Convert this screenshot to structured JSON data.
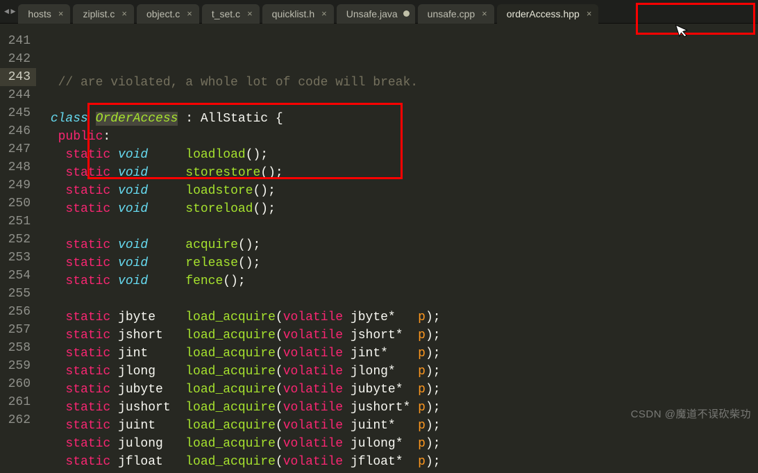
{
  "tabs": [
    {
      "label": "hosts",
      "dirty": false
    },
    {
      "label": "ziplist.c",
      "dirty": false
    },
    {
      "label": "object.c",
      "dirty": false
    },
    {
      "label": "t_set.c",
      "dirty": false
    },
    {
      "label": "quicklist.h",
      "dirty": false
    },
    {
      "label": "Unsafe.java",
      "dirty": true
    },
    {
      "label": "unsafe.cpp",
      "dirty": false
    },
    {
      "label": "orderAccess.hpp",
      "dirty": false,
      "active": true
    }
  ],
  "line_start": 241,
  "active_line": 243,
  "code_lines": [
    {
      "n": 241,
      "tokens": [
        {
          "t": "  // are violated, a whole lot of code will break.",
          "c": "c-comment"
        }
      ]
    },
    {
      "n": 242,
      "tokens": [
        {
          "t": " ",
          "c": "c-plain"
        }
      ]
    },
    {
      "n": 243,
      "tokens": [
        {
          "t": " ",
          "c": "c-plain"
        },
        {
          "t": "class",
          "c": "c-type"
        },
        {
          "t": " ",
          "c": "c-plain"
        },
        {
          "t": "OrderAccess",
          "c": "c-classname"
        },
        {
          "t": " : ",
          "c": "c-plain"
        },
        {
          "t": "AllStatic",
          "c": "c-plain"
        },
        {
          "t": " {",
          "c": "c-plain"
        }
      ]
    },
    {
      "n": 244,
      "tokens": [
        {
          "t": "  ",
          "c": "c-plain"
        },
        {
          "t": "public",
          "c": "c-keyword"
        },
        {
          "t": ":",
          "c": "c-plain"
        }
      ]
    },
    {
      "n": 245,
      "tokens": [
        {
          "t": "   ",
          "c": "c-plain"
        },
        {
          "t": "static",
          "c": "c-keyword"
        },
        {
          "t": " ",
          "c": "c-plain"
        },
        {
          "t": "void",
          "c": "c-type"
        },
        {
          "t": "     ",
          "c": "c-plain"
        },
        {
          "t": "loadload",
          "c": "c-func"
        },
        {
          "t": "();",
          "c": "c-plain"
        }
      ]
    },
    {
      "n": 246,
      "tokens": [
        {
          "t": "   ",
          "c": "c-plain"
        },
        {
          "t": "static",
          "c": "c-keyword"
        },
        {
          "t": " ",
          "c": "c-plain"
        },
        {
          "t": "void",
          "c": "c-type"
        },
        {
          "t": "     ",
          "c": "c-plain"
        },
        {
          "t": "storestore",
          "c": "c-func"
        },
        {
          "t": "();",
          "c": "c-plain"
        }
      ]
    },
    {
      "n": 247,
      "tokens": [
        {
          "t": "   ",
          "c": "c-plain"
        },
        {
          "t": "static",
          "c": "c-keyword"
        },
        {
          "t": " ",
          "c": "c-plain"
        },
        {
          "t": "void",
          "c": "c-type"
        },
        {
          "t": "     ",
          "c": "c-plain"
        },
        {
          "t": "loadstore",
          "c": "c-func"
        },
        {
          "t": "();",
          "c": "c-plain"
        }
      ]
    },
    {
      "n": 248,
      "tokens": [
        {
          "t": "   ",
          "c": "c-plain"
        },
        {
          "t": "static",
          "c": "c-keyword"
        },
        {
          "t": " ",
          "c": "c-plain"
        },
        {
          "t": "void",
          "c": "c-type"
        },
        {
          "t": "     ",
          "c": "c-plain"
        },
        {
          "t": "storeload",
          "c": "c-func"
        },
        {
          "t": "();",
          "c": "c-plain"
        }
      ]
    },
    {
      "n": 249,
      "tokens": [
        {
          "t": " ",
          "c": "c-plain"
        }
      ]
    },
    {
      "n": 250,
      "tokens": [
        {
          "t": "   ",
          "c": "c-plain"
        },
        {
          "t": "static",
          "c": "c-keyword"
        },
        {
          "t": " ",
          "c": "c-plain"
        },
        {
          "t": "void",
          "c": "c-type"
        },
        {
          "t": "     ",
          "c": "c-plain"
        },
        {
          "t": "acquire",
          "c": "c-func"
        },
        {
          "t": "();",
          "c": "c-plain"
        }
      ]
    },
    {
      "n": 251,
      "tokens": [
        {
          "t": "   ",
          "c": "c-plain"
        },
        {
          "t": "static",
          "c": "c-keyword"
        },
        {
          "t": " ",
          "c": "c-plain"
        },
        {
          "t": "void",
          "c": "c-type"
        },
        {
          "t": "     ",
          "c": "c-plain"
        },
        {
          "t": "release",
          "c": "c-func"
        },
        {
          "t": "();",
          "c": "c-plain"
        }
      ]
    },
    {
      "n": 252,
      "tokens": [
        {
          "t": "   ",
          "c": "c-plain"
        },
        {
          "t": "static",
          "c": "c-keyword"
        },
        {
          "t": " ",
          "c": "c-plain"
        },
        {
          "t": "void",
          "c": "c-type"
        },
        {
          "t": "     ",
          "c": "c-plain"
        },
        {
          "t": "fence",
          "c": "c-func"
        },
        {
          "t": "();",
          "c": "c-plain"
        }
      ]
    },
    {
      "n": 253,
      "tokens": [
        {
          "t": " ",
          "c": "c-plain"
        }
      ]
    },
    {
      "n": 254,
      "tokens": [
        {
          "t": "   ",
          "c": "c-plain"
        },
        {
          "t": "static",
          "c": "c-keyword"
        },
        {
          "t": " jbyte    ",
          "c": "c-plain"
        },
        {
          "t": "load_acquire",
          "c": "c-func"
        },
        {
          "t": "(",
          "c": "c-plain"
        },
        {
          "t": "volatile",
          "c": "c-keyword"
        },
        {
          "t": " jbyte*   ",
          "c": "c-plain"
        },
        {
          "t": "p",
          "c": "c-param"
        },
        {
          "t": ");",
          "c": "c-plain"
        }
      ]
    },
    {
      "n": 255,
      "tokens": [
        {
          "t": "   ",
          "c": "c-plain"
        },
        {
          "t": "static",
          "c": "c-keyword"
        },
        {
          "t": " jshort   ",
          "c": "c-plain"
        },
        {
          "t": "load_acquire",
          "c": "c-func"
        },
        {
          "t": "(",
          "c": "c-plain"
        },
        {
          "t": "volatile",
          "c": "c-keyword"
        },
        {
          "t": " jshort*  ",
          "c": "c-plain"
        },
        {
          "t": "p",
          "c": "c-param"
        },
        {
          "t": ");",
          "c": "c-plain"
        }
      ]
    },
    {
      "n": 256,
      "tokens": [
        {
          "t": "   ",
          "c": "c-plain"
        },
        {
          "t": "static",
          "c": "c-keyword"
        },
        {
          "t": " jint     ",
          "c": "c-plain"
        },
        {
          "t": "load_acquire",
          "c": "c-func"
        },
        {
          "t": "(",
          "c": "c-plain"
        },
        {
          "t": "volatile",
          "c": "c-keyword"
        },
        {
          "t": " jint*    ",
          "c": "c-plain"
        },
        {
          "t": "p",
          "c": "c-param"
        },
        {
          "t": ");",
          "c": "c-plain"
        }
      ]
    },
    {
      "n": 257,
      "tokens": [
        {
          "t": "   ",
          "c": "c-plain"
        },
        {
          "t": "static",
          "c": "c-keyword"
        },
        {
          "t": " jlong    ",
          "c": "c-plain"
        },
        {
          "t": "load_acquire",
          "c": "c-func"
        },
        {
          "t": "(",
          "c": "c-plain"
        },
        {
          "t": "volatile",
          "c": "c-keyword"
        },
        {
          "t": " jlong*   ",
          "c": "c-plain"
        },
        {
          "t": "p",
          "c": "c-param"
        },
        {
          "t": ");",
          "c": "c-plain"
        }
      ]
    },
    {
      "n": 258,
      "tokens": [
        {
          "t": "   ",
          "c": "c-plain"
        },
        {
          "t": "static",
          "c": "c-keyword"
        },
        {
          "t": " jubyte   ",
          "c": "c-plain"
        },
        {
          "t": "load_acquire",
          "c": "c-func"
        },
        {
          "t": "(",
          "c": "c-plain"
        },
        {
          "t": "volatile",
          "c": "c-keyword"
        },
        {
          "t": " jubyte*  ",
          "c": "c-plain"
        },
        {
          "t": "p",
          "c": "c-param"
        },
        {
          "t": ");",
          "c": "c-plain"
        }
      ]
    },
    {
      "n": 259,
      "tokens": [
        {
          "t": "   ",
          "c": "c-plain"
        },
        {
          "t": "static",
          "c": "c-keyword"
        },
        {
          "t": " jushort  ",
          "c": "c-plain"
        },
        {
          "t": "load_acquire",
          "c": "c-func"
        },
        {
          "t": "(",
          "c": "c-plain"
        },
        {
          "t": "volatile",
          "c": "c-keyword"
        },
        {
          "t": " jushort* ",
          "c": "c-plain"
        },
        {
          "t": "p",
          "c": "c-param"
        },
        {
          "t": ");",
          "c": "c-plain"
        }
      ]
    },
    {
      "n": 260,
      "tokens": [
        {
          "t": "   ",
          "c": "c-plain"
        },
        {
          "t": "static",
          "c": "c-keyword"
        },
        {
          "t": " juint    ",
          "c": "c-plain"
        },
        {
          "t": "load_acquire",
          "c": "c-func"
        },
        {
          "t": "(",
          "c": "c-plain"
        },
        {
          "t": "volatile",
          "c": "c-keyword"
        },
        {
          "t": " juint*   ",
          "c": "c-plain"
        },
        {
          "t": "p",
          "c": "c-param"
        },
        {
          "t": ");",
          "c": "c-plain"
        }
      ]
    },
    {
      "n": 261,
      "tokens": [
        {
          "t": "   ",
          "c": "c-plain"
        },
        {
          "t": "static",
          "c": "c-keyword"
        },
        {
          "t": " julong   ",
          "c": "c-plain"
        },
        {
          "t": "load_acquire",
          "c": "c-func"
        },
        {
          "t": "(",
          "c": "c-plain"
        },
        {
          "t": "volatile",
          "c": "c-keyword"
        },
        {
          "t": " julong*  ",
          "c": "c-plain"
        },
        {
          "t": "p",
          "c": "c-param"
        },
        {
          "t": ");",
          "c": "c-plain"
        }
      ]
    },
    {
      "n": 262,
      "tokens": [
        {
          "t": "   ",
          "c": "c-plain"
        },
        {
          "t": "static",
          "c": "c-keyword"
        },
        {
          "t": " jfloat   ",
          "c": "c-plain"
        },
        {
          "t": "load_acquire",
          "c": "c-func"
        },
        {
          "t": "(",
          "c": "c-plain"
        },
        {
          "t": "volatile",
          "c": "c-keyword"
        },
        {
          "t": " jfloat*  ",
          "c": "c-plain"
        },
        {
          "t": "p",
          "c": "c-param"
        },
        {
          "t": ");",
          "c": "c-plain"
        }
      ]
    }
  ],
  "watermark": "CSDN @魔道不误砍柴功",
  "nav": {
    "left": "◄",
    "right": "►"
  }
}
